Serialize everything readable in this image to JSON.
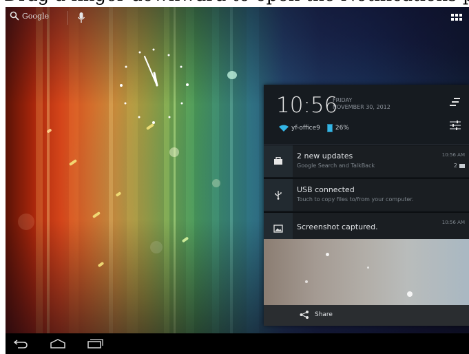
{
  "caption": {
    "text": "Drag a finger downward to open the Notifications panel as"
  },
  "topbar": {
    "search_label": "Google"
  },
  "panel": {
    "time": "10:56",
    "day": "FRIDAY",
    "date": "NOVEMBER 30, 2012",
    "network": "yf-office9",
    "battery": "26%"
  },
  "notifications": [
    {
      "title": "2 new updates",
      "subtitle": "Google Search and TalkBack",
      "time": "10:56 AM",
      "count": "2",
      "icon": "briefcase-icon"
    },
    {
      "title": "USB connected",
      "subtitle": "Touch to copy files to/from your computer.",
      "time": "",
      "icon": "usb-icon"
    },
    {
      "title": "Screenshot captured.",
      "subtitle": "",
      "time": "10:56 AM",
      "icon": "image-icon"
    }
  ],
  "share": {
    "label": "Share"
  },
  "colors": {
    "accent": "#33b5e5",
    "panel_bg": "#101418"
  }
}
